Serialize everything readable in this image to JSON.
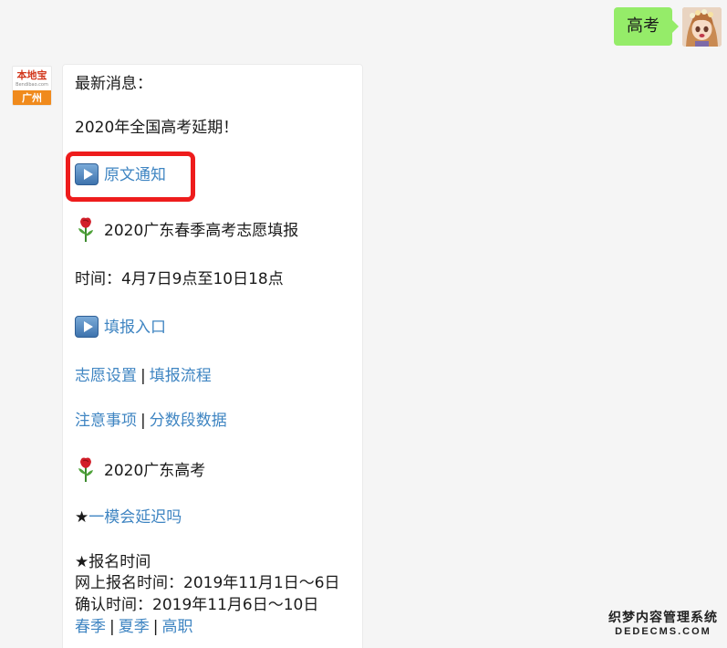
{
  "outgoing": {
    "text": "高考"
  },
  "bot": {
    "brand": "本地宝",
    "brand_sub": "Bendibao.com",
    "city": "广州"
  },
  "message": {
    "latest": "最新消息：",
    "headline": "2020年全国高考延期！",
    "notice_link": "原文通知",
    "section1_title": "2020广东春季高考志愿填报",
    "time_line": "时间：4月7日9点至10日18点",
    "entry_link": "填报入口",
    "links_row1": [
      "志愿设置",
      "填报流程"
    ],
    "links_row2": [
      "注意事项",
      "分数段数据"
    ],
    "section2_title": "2020广东高考",
    "mock_link": "一模会延迟吗",
    "reg_title": "★报名时间",
    "online_reg": "网上报名时间：2019年11月1日～6日",
    "confirm": "确认时间：2019年11月6日～10日",
    "links_row3": [
      "春季",
      "夏季",
      "高职"
    ],
    "star": "★",
    "separator": "|"
  },
  "watermark": {
    "cn": "织梦内容管理系统",
    "en": "DEDECMS.COM"
  },
  "colors": {
    "link": "#3f85c2",
    "bubble_out": "#95ec69",
    "highlight": "#ee1c1c",
    "background": "#f5f5f5"
  }
}
